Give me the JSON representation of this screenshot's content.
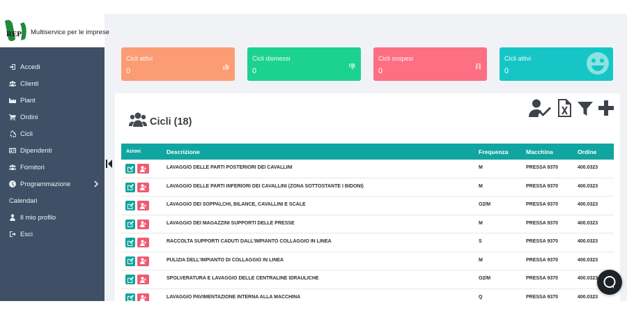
{
  "brand": {
    "logo_text": "REP",
    "tagline": "Multiservice per le imprese"
  },
  "sidebar": {
    "items": [
      {
        "label": "Accedi",
        "icon": "sign-in-icon"
      },
      {
        "label": "Clienti",
        "icon": "users-icon"
      },
      {
        "label": "Plant",
        "icon": "industry-icon"
      },
      {
        "label": "Ordini",
        "icon": "cart-icon"
      },
      {
        "label": "Cicli",
        "icon": "recycle-icon"
      },
      {
        "label": "Dipendenti",
        "icon": "id-card-icon"
      },
      {
        "label": "Fornitori",
        "icon": "users-icon"
      },
      {
        "label": "Programmazione",
        "icon": "clock-icon",
        "has_submenu": true
      },
      {
        "label": "Calendari",
        "icon": ""
      },
      {
        "label": "Il mio profilo",
        "icon": "user-icon"
      },
      {
        "label": "Esci",
        "icon": "sign-out-icon"
      }
    ]
  },
  "cards": [
    {
      "label": "Cicli attivi",
      "value": "0",
      "color": "#fc9c74",
      "icon": "thumbs-up-icon"
    },
    {
      "label": "Cicli dismessi",
      "value": "0",
      "color": "#1bd28e",
      "icon": "thumbs-down-icon"
    },
    {
      "label": "Cicli sospesi",
      "value": "0",
      "color": "#fd6f83",
      "icon": "pause-icon"
    },
    {
      "label": "Cicli attivi",
      "value": "0",
      "color": "#16c6c6",
      "icon": "smile-icon"
    }
  ],
  "panel": {
    "title": "Cicli (18)",
    "toolbar": [
      "assign-user-icon",
      "excel-export-icon",
      "filter-icon",
      "add-icon"
    ]
  },
  "table": {
    "headers": {
      "actions": "Azioni",
      "description": "Descrizione",
      "frequency": "Frequenza",
      "machine": "Macchina",
      "order": "Ordine"
    },
    "rows": [
      {
        "description": "LAVAGGIO DELLE PARTI POSTERIORI DEI CAVALLINI",
        "frequency": "M",
        "machine": "PRESSA 9370",
        "order": "400.0323"
      },
      {
        "description": "LAVAGGIO DELLE PARTI INFERIORI DEI CAVALLINI (ZONA SOTTOSTANTE I BIDONI)",
        "frequency": "M",
        "machine": "PRESSA 9370",
        "order": "400.0323"
      },
      {
        "description": "LAVAGGIO DEI SOPPALCHI, BILANCE, CAVALLINI E SCALE",
        "frequency": "O2/M",
        "machine": "PRESSA 9370",
        "order": "400.0323"
      },
      {
        "description": "LAVAGGIO DEI MAGAZZINI SUPPORTI DELLE PRESSE",
        "frequency": "M",
        "machine": "PRESSA 9370",
        "order": "400.0323"
      },
      {
        "description": "RACCOLTA SUPPORTI CADUTI DALL'IMPIANTO COLLAGGIO IN LINEA",
        "frequency": "S",
        "machine": "PRESSA 9370",
        "order": "400.0323"
      },
      {
        "description": "PULIZIA DELL'IMPIANTO DI COLLAGGIO IN LINEA",
        "frequency": "M",
        "machine": "PRESSA 9370",
        "order": "400.0323"
      },
      {
        "description": "SPOLVERATURA E LAVAGGIO DELLE CENTRALINE IDRAULICHE",
        "frequency": "O2/M",
        "machine": "PRESSA 9370",
        "order": "400.0323"
      },
      {
        "description": "LAVAGGIO PAVIMENTAZIONE INTERNA ALLA MACCHINA",
        "frequency": "Q",
        "machine": "PRESSA 9370",
        "order": "400.0323"
      }
    ]
  },
  "colors": {
    "sidebar": "#3f4f66",
    "teal": "#10a5a0",
    "danger": "#f05a72"
  }
}
